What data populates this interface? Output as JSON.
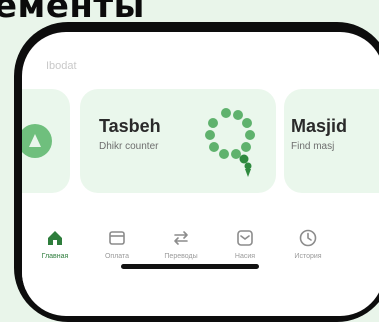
{
  "headline": "ементы",
  "section": {
    "label": "Ibodat"
  },
  "cards": [
    {
      "title": "",
      "subtitle": ""
    },
    {
      "title": "Tasbeh",
      "subtitle": "Dhikr counter"
    },
    {
      "title": "Masjid",
      "subtitle": "Find masj"
    }
  ],
  "tabs": [
    {
      "label": "Главная",
      "icon": "home-icon",
      "active": true
    },
    {
      "label": "Оплата",
      "icon": "wallet-icon",
      "active": false
    },
    {
      "label": "Переводы",
      "icon": "transfer-icon",
      "active": false
    },
    {
      "label": "Насия",
      "icon": "inbox-icon",
      "active": false
    },
    {
      "label": "История",
      "icon": "clock-icon",
      "active": false
    }
  ],
  "colors": {
    "accent": "#2e7d3c",
    "card_bg": "#eaf7ec",
    "page_bg": "#e9f5ea",
    "phone_frame": "#0d0d0d"
  }
}
